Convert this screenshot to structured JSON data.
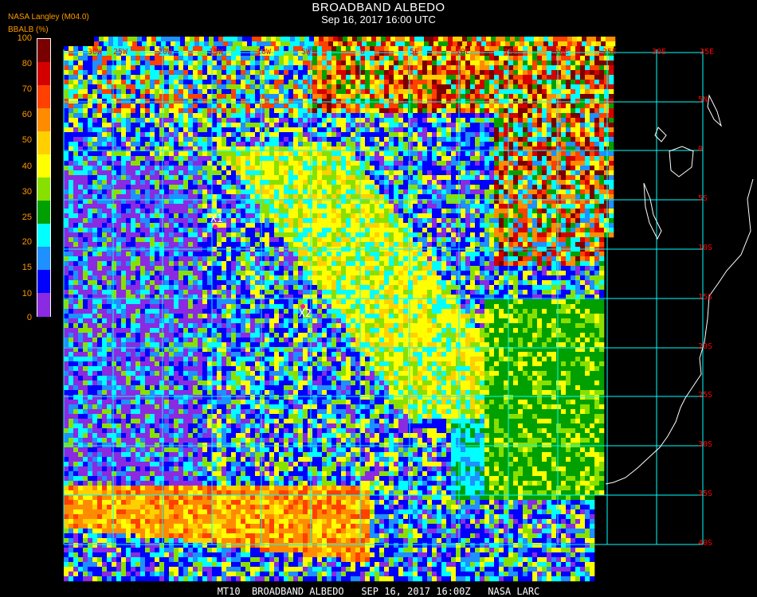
{
  "header": {
    "title": "BROADBAND ALBEDO",
    "subtitle": "Sep 16, 2017 16:00 UTC",
    "source": "NASA Langley (M04.0)",
    "units": "BBALB (%)"
  },
  "colorbar": {
    "ticks": [
      "100",
      "80",
      "70",
      "60",
      "50",
      "40",
      "30",
      "25",
      "20",
      "15",
      "10",
      "0"
    ],
    "colors": [
      "#7a0000",
      "#d40000",
      "#ff4000",
      "#ff8c00",
      "#ffd000",
      "#ffff00",
      "#88e000",
      "#00a000",
      "#00ffff",
      "#1e90ff",
      "#0000ff",
      "#8a2be2"
    ]
  },
  "map": {
    "lon_labels": [
      "30W",
      "25W",
      "20W",
      "15W",
      "10W",
      "5W",
      "0",
      "5E",
      "10E",
      "15E",
      "20E",
      "25E",
      "30E",
      "35E"
    ],
    "lat_labels": [
      "5N",
      "0",
      "5S",
      "10S",
      "15S",
      "20S",
      "25S",
      "30S",
      "35S",
      "40S"
    ],
    "markers": [
      {
        "label": "X1",
        "color": "#ff1493"
      },
      {
        "label": "X2",
        "color": "#ff1493"
      }
    ],
    "colors": {
      "grid": "#00ffff",
      "coast": "#ffffff",
      "labels": "#ff0000"
    }
  },
  "footer": {
    "text": "MT10  BROADBAND ALBEDO   SEP 16, 2017 16:00Z   NASA LARC"
  }
}
